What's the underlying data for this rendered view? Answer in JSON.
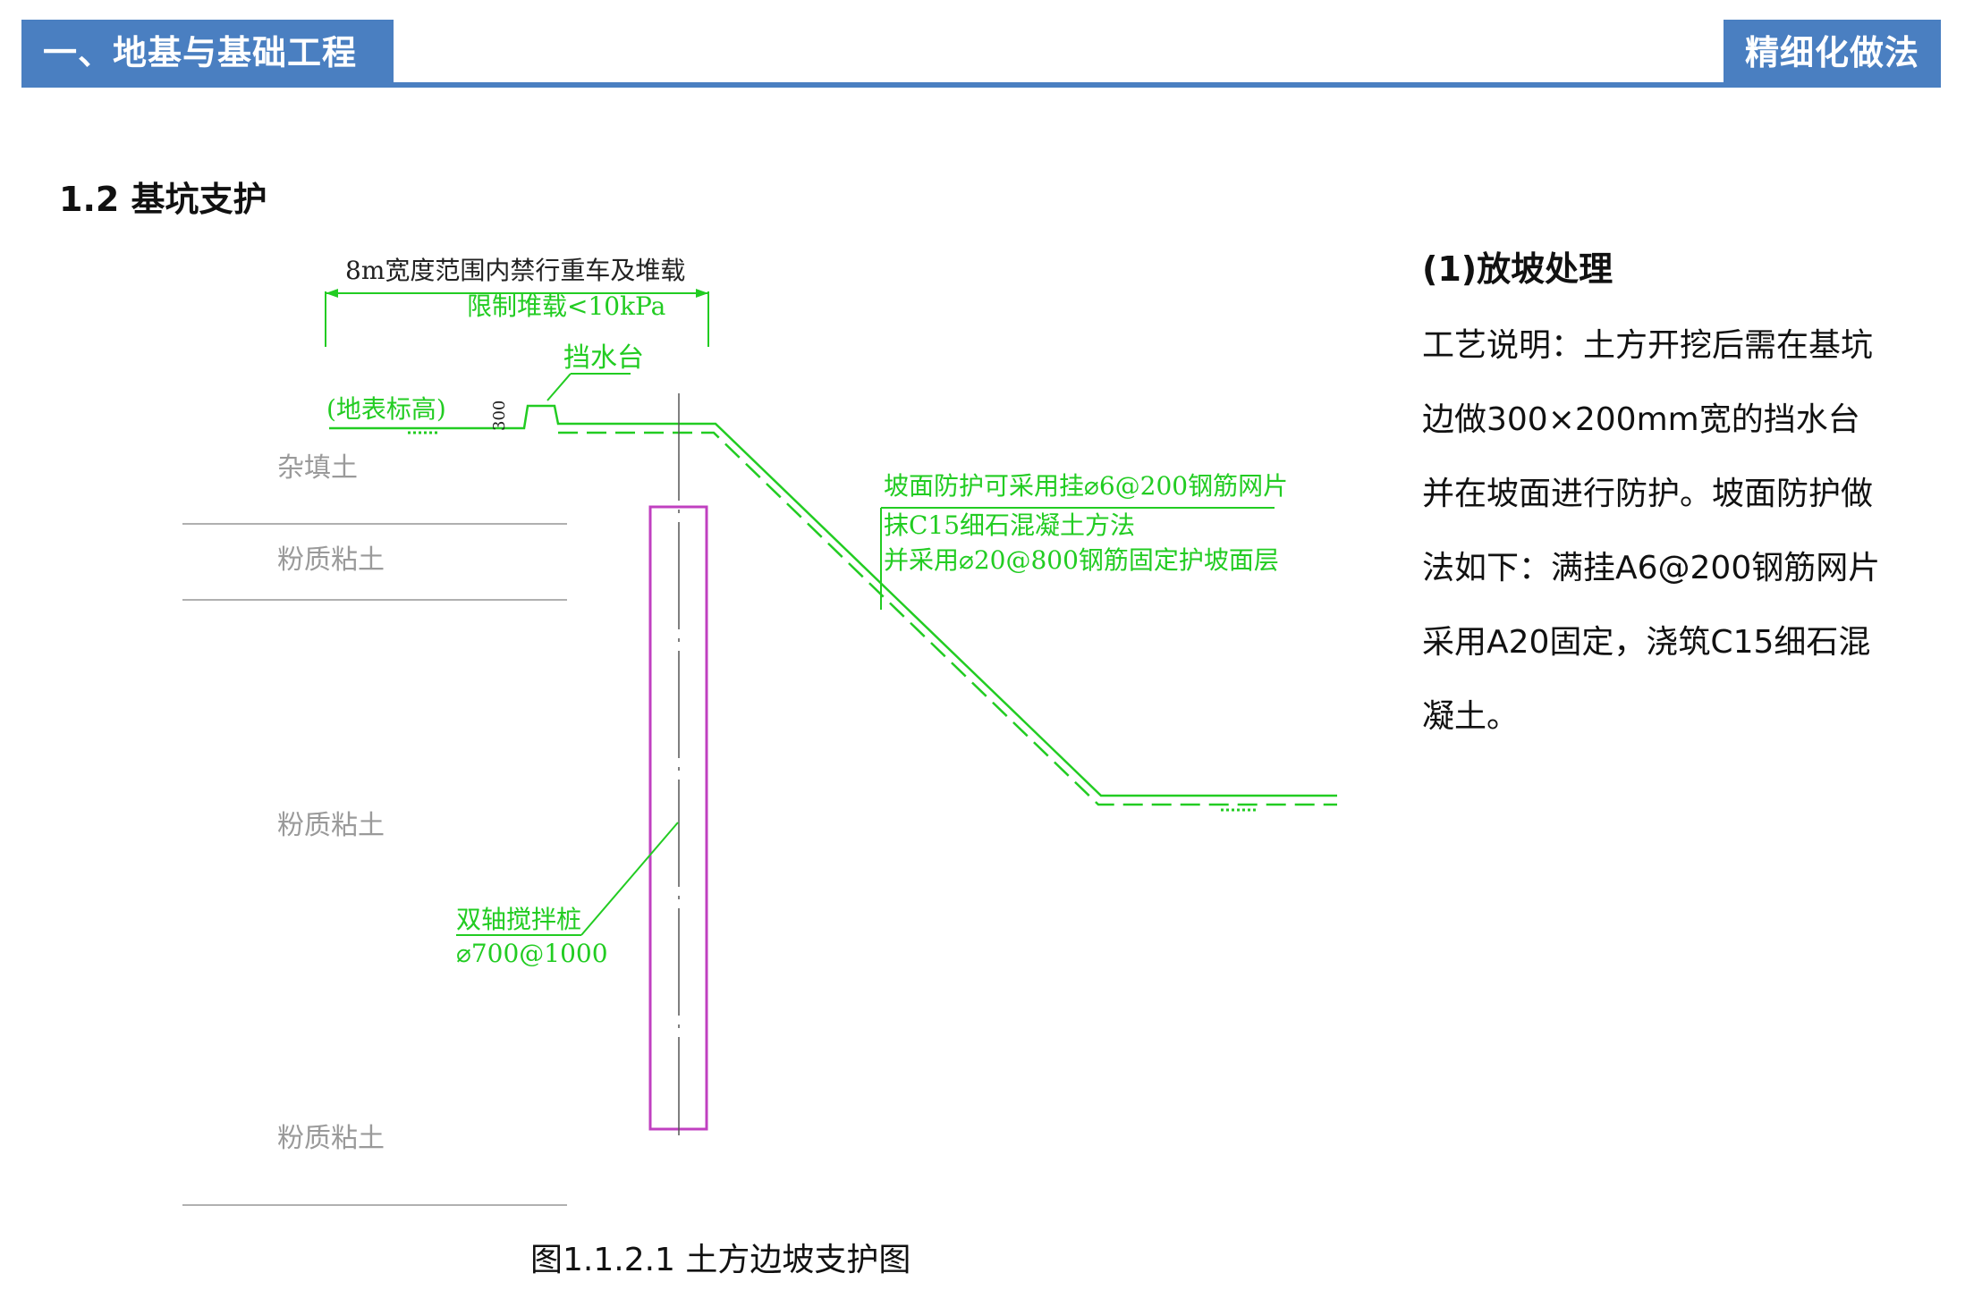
{
  "header": {
    "chapter": "一、地基与基础工程",
    "badge": "精细化做法",
    "colors": {
      "bar": "#4a7fc1",
      "text": "#ffffff"
    }
  },
  "section": {
    "title": "1.2 基坑支护"
  },
  "figure": {
    "caption": "图1.1.2.1 土方边坡支护图",
    "annotations": {
      "width_limit": "8m宽度范围内禁行重车及堆载",
      "load_limit": "限制堆载<10kPa",
      "water_stop": "挡水台",
      "ground_level": "(地表标高)",
      "dimension_300": "300",
      "slope_line1": "坡面防护可采用挂⌀6@200钢筋网片",
      "slope_line2": "抹C15细石混凝土方法",
      "slope_line3": "并采用⌀20@800钢筋固定护坡面层",
      "pile_name": "双轴搅拌桩",
      "pile_spec": "⌀700@1000"
    },
    "soil_layers": [
      "杂填土",
      "粉质粘土",
      "粉质粘土",
      "粉质粘土"
    ],
    "colors": {
      "annotation": "#22cc22",
      "pile": "#c040c0",
      "soil_label": "#9a9a9a",
      "layer_line": "#b0b0b0"
    }
  },
  "description": {
    "heading": "(1)放坡处理",
    "body": "工艺说明：土方开挖后需在基坑边做300×200mm宽的挡水台并在坡面进行防护。坡面防护做法如下：满挂A6@200钢筋网片采用A20固定，浇筑C15细石混凝土。"
  }
}
